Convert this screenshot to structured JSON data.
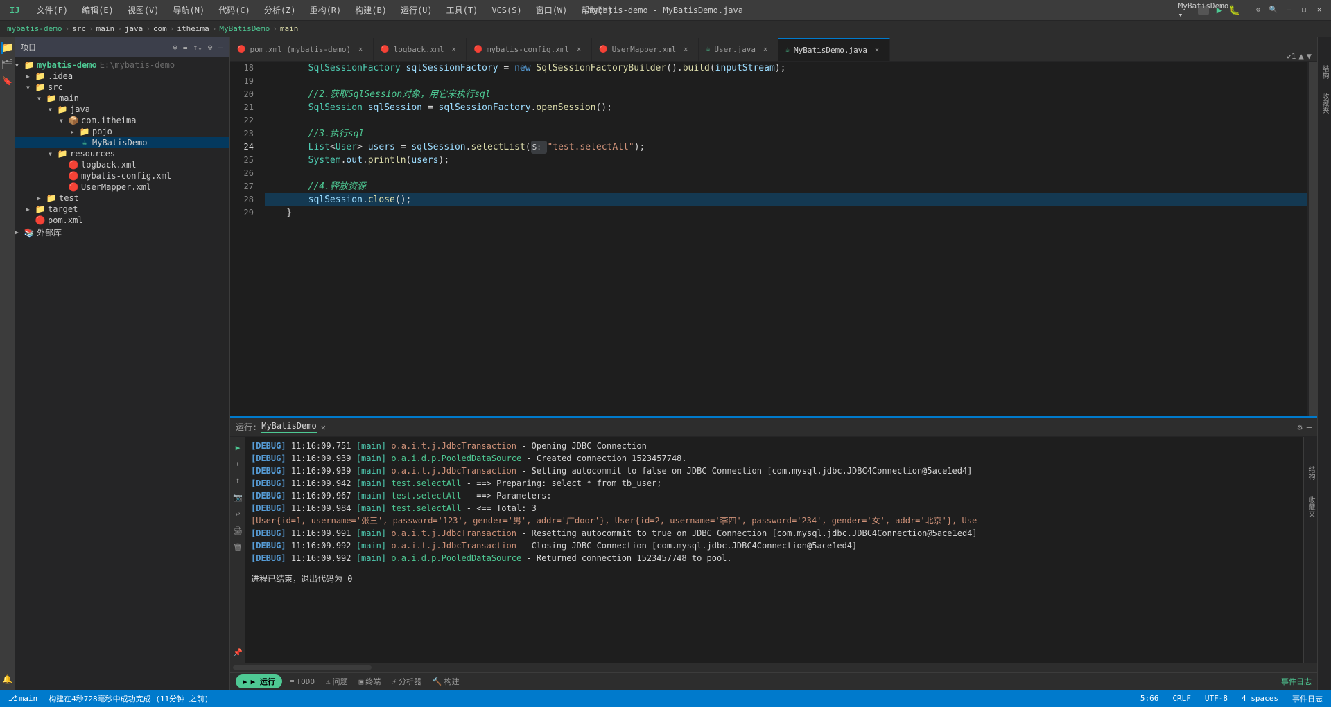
{
  "titleBar": {
    "menuItems": [
      "文件(F)",
      "编辑(E)",
      "视图(V)",
      "导航(N)",
      "代码(C)",
      "分析(Z)",
      "重构(R)",
      "构建(B)",
      "运行(U)",
      "工具(T)",
      "VCS(S)",
      "窗口(W)",
      "帮助(H)"
    ],
    "title": "mybatis-demo - MyBatisDemo.java",
    "windowControls": [
      "—",
      "□",
      "✕"
    ]
  },
  "breadcrumb": {
    "items": [
      "mybatis-demo",
      "src",
      "main",
      "java",
      "com",
      "itheima",
      "MyBatisDemo",
      "main"
    ]
  },
  "toolbar": {
    "projectLabel": "项目",
    "icons": [
      "⊕",
      "≡",
      "↑↓",
      "⚙",
      "—"
    ]
  },
  "sidebar": {
    "header": "项目",
    "tree": [
      {
        "id": "mybatis-demo",
        "label": "mybatis-demo E:\\mybatis-demo",
        "indent": 0,
        "icon": "📁",
        "expanded": true,
        "type": "root"
      },
      {
        "id": "idea",
        "label": ".idea",
        "indent": 1,
        "icon": "📁",
        "expanded": false,
        "type": "folder"
      },
      {
        "id": "src",
        "label": "src",
        "indent": 1,
        "icon": "📁",
        "expanded": true,
        "type": "folder"
      },
      {
        "id": "main",
        "label": "main",
        "indent": 2,
        "icon": "📁",
        "expanded": true,
        "type": "folder"
      },
      {
        "id": "java",
        "label": "java",
        "indent": 3,
        "icon": "📁",
        "expanded": true,
        "type": "folder"
      },
      {
        "id": "com-itheima",
        "label": "com.itheima",
        "indent": 4,
        "icon": "📦",
        "expanded": true,
        "type": "package"
      },
      {
        "id": "pojo",
        "label": "pojo",
        "indent": 5,
        "icon": "📁",
        "expanded": false,
        "type": "folder"
      },
      {
        "id": "mybatisdemo",
        "label": "MyBatisDemo",
        "indent": 5,
        "icon": "☕",
        "expanded": false,
        "type": "java",
        "selected": true
      },
      {
        "id": "resources",
        "label": "resources",
        "indent": 3,
        "icon": "📁",
        "expanded": true,
        "type": "folder"
      },
      {
        "id": "logback",
        "label": "logback.xml",
        "indent": 4,
        "icon": "🔴",
        "expanded": false,
        "type": "xml"
      },
      {
        "id": "mybatis-config",
        "label": "mybatis-config.xml",
        "indent": 4,
        "icon": "🔴",
        "expanded": false,
        "type": "xml"
      },
      {
        "id": "usermapper",
        "label": "UserMapper.xml",
        "indent": 4,
        "icon": "🔴",
        "expanded": false,
        "type": "xml"
      },
      {
        "id": "test",
        "label": "test",
        "indent": 2,
        "icon": "📁",
        "expanded": false,
        "type": "folder"
      },
      {
        "id": "target",
        "label": "target",
        "indent": 1,
        "icon": "📁",
        "expanded": false,
        "type": "folder"
      },
      {
        "id": "pom",
        "label": "pom.xml",
        "indent": 1,
        "icon": "🔴",
        "expanded": false,
        "type": "xml"
      },
      {
        "id": "external",
        "label": "外部库",
        "indent": 0,
        "icon": "📚",
        "expanded": false,
        "type": "libs"
      }
    ]
  },
  "tabs": [
    {
      "label": "pom.xml (mybatis-demo)",
      "icon": "🔴",
      "active": false,
      "modified": false
    },
    {
      "label": "logback.xml",
      "icon": "🔴",
      "active": false,
      "modified": false
    },
    {
      "label": "mybatis-config.xml",
      "icon": "🔴",
      "active": false,
      "modified": false
    },
    {
      "label": "UserMapper.xml",
      "icon": "🔴",
      "active": false,
      "modified": false
    },
    {
      "label": "User.java",
      "icon": "☕",
      "active": false,
      "modified": false
    },
    {
      "label": "MyBatisDemo.java",
      "icon": "☕",
      "active": true,
      "modified": false
    }
  ],
  "codeLines": [
    {
      "num": 18,
      "content": "        SqlSessionFactory sqlSessionFactory = new SqlSessionFactoryBuilder().build(inputStream);",
      "highlighted": false
    },
    {
      "num": 19,
      "content": "",
      "highlighted": false
    },
    {
      "num": 20,
      "content": "        //2.获取SqlSession对象，用它来执行sql",
      "highlighted": false,
      "isComment": true
    },
    {
      "num": 21,
      "content": "        SqlSession sqlSession = sqlSessionFactory.openSession();",
      "highlighted": false
    },
    {
      "num": 22,
      "content": "",
      "highlighted": false
    },
    {
      "num": 23,
      "content": "        //3.执行sql",
      "highlighted": false,
      "isComment": true
    },
    {
      "num": 24,
      "content": "        List<User> users = sqlSession.selectList(S: \"test.selectAll\");",
      "highlighted": false
    },
    {
      "num": 25,
      "content": "        System.out.println(users);",
      "highlighted": false
    },
    {
      "num": 26,
      "content": "",
      "highlighted": false
    },
    {
      "num": 27,
      "content": "        //4.释放资源",
      "highlighted": false,
      "isComment": true
    },
    {
      "num": 28,
      "content": "        sqlSession.close();",
      "highlighted": true
    },
    {
      "num": 29,
      "content": "    }",
      "highlighted": false
    }
  ],
  "bottomPanel": {
    "runTab": "MyBatisDemo",
    "consoleLines": [
      {
        "level": "DEBUG",
        "time": "11:16:09.751",
        "thread": "[main]",
        "class": "o.a.i.t.j.JdbcTransaction",
        "separator": "-",
        "message": "Opening JDBC Connection"
      },
      {
        "level": "DEBUG",
        "time": "11:16:09.939",
        "thread": "[main]",
        "class": "o.a.i.d.p.PooledDataSource",
        "separator": "-",
        "message": "Created connection 1523457748."
      },
      {
        "level": "DEBUG",
        "time": "11:16:09.939",
        "thread": "[main]",
        "class": "o.a.i.t.j.JdbcTransaction",
        "separator": "-",
        "message": "Setting autocommit to false on JDBC Connection [com.mysql.jdbc.JDBC4Connection@5ace1ed4]"
      },
      {
        "level": "DEBUG",
        "time": "11:16:09.942",
        "thread": "[main]",
        "class": "test.selectAll",
        "separator": "-",
        "message": "==>  Preparing: select * from tb_user;"
      },
      {
        "level": "DEBUG",
        "time": "11:16:09.967",
        "thread": "[main]",
        "class": "test.selectAll",
        "separator": "-",
        "message": "==> Parameters:"
      },
      {
        "level": "DEBUG",
        "time": "11:16:09.984",
        "thread": "[main]",
        "class": "test.selectAll",
        "separator": "-",
        "message": "<==      Total: 3"
      },
      {
        "level": "DATA",
        "time": "",
        "thread": "",
        "class": "",
        "separator": "",
        "message": "[User{id=1, username='张三', password='123', gender='男', addr='广door'}, User{id=2, username='李四', password='234', gender='女', addr='北京'}, Use"
      },
      {
        "level": "DEBUG",
        "time": "11:16:09.991",
        "thread": "[main]",
        "class": "o.a.i.t.j.JdbcTransaction",
        "separator": "-",
        "message": "Resetting autocommit to true on JDBC Connection [com.mysql.jdbc.JDBC4Connection@5ace1ed4]"
      },
      {
        "level": "DEBUG",
        "time": "11:16:09.992",
        "thread": "[main]",
        "class": "o.a.i.t.j.JdbcTransaction",
        "separator": "-",
        "message": "Closing JDBC Connection [com.mysql.jdbc.JDBC4Connection@5ace1ed4]"
      },
      {
        "level": "DEBUG",
        "time": "11:16:09.992",
        "thread": "[main]",
        "class": "o.a.i.d.p.PooledDataSource",
        "separator": "-",
        "message": "Returned connection 1523457748 to pool."
      }
    ],
    "exitMessage": "进程已结束，退出代码为 0"
  },
  "statusBar": {
    "buildMessage": "构建在4秒728毫秒中成功完成 (11分钟 之前)",
    "right": {
      "position": "5:66",
      "encoding": "CRLF",
      "charset": "UTF-8",
      "indentation": "4 spaces",
      "eventLog": "事件日志"
    }
  },
  "bottomBar": {
    "runLabel": "▶ 运行",
    "todoLabel": "≡ TODO",
    "issuesLabel": "⚠ 问题",
    "terminalLabel": "▣ 终端",
    "profilerLabel": "⚡ 分析器",
    "buildLabel": "🔨 构建"
  },
  "colors": {
    "accent": "#007acc",
    "green": "#4ec994",
    "orange": "#ce9178",
    "blue": "#569cd6",
    "teal": "#4ec9b0",
    "debugColor": "#569cd6",
    "pooledColor": "#4ec994"
  }
}
